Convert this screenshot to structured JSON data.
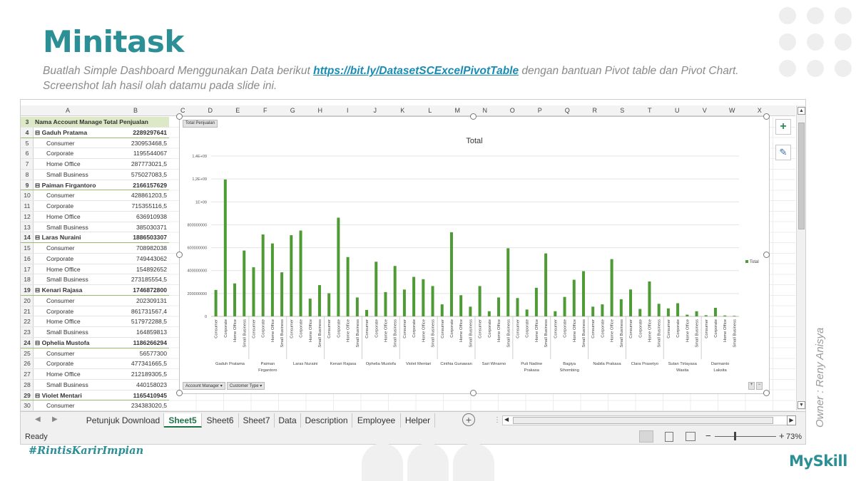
{
  "slide": {
    "title": "Minitask",
    "subtitle_pre": "Buatlah Simple Dashboard Menggunakan Data berikut ",
    "subtitle_link": "https://bit.ly/DatasetSCExcelPivotTable",
    "subtitle_post": " dengan bantuan Pivot table dan Pivot Chart. Screenshot lah hasil olah datamu pada slide ini.",
    "owner": "Owner : Reny Anisya",
    "hashtag": "#RintisKarirImpian",
    "brand": "MySkill"
  },
  "excel": {
    "columns": [
      "A",
      "B",
      "C",
      "D",
      "E",
      "F",
      "G",
      "H",
      "I",
      "J",
      "K",
      "L",
      "M",
      "N",
      "O",
      "P",
      "Q",
      "R",
      "S",
      "T",
      "U",
      "V",
      "W",
      "X"
    ],
    "header_row": {
      "row": "3",
      "a": "Nama Account Manage →",
      "b": "Total Penjualan"
    },
    "rows": [
      {
        "row": "4",
        "a": "⊟ Gaduh Pratama",
        "b": "2289297641",
        "type": "mgr"
      },
      {
        "row": "5",
        "a": "Consumer",
        "b": "230953468,5",
        "type": "sub"
      },
      {
        "row": "6",
        "a": "Corporate",
        "b": "1195544067",
        "type": "sub"
      },
      {
        "row": "7",
        "a": "Home Office",
        "b": "287773021,5",
        "type": "sub"
      },
      {
        "row": "8",
        "a": "Small Business",
        "b": "575027083,5",
        "type": "sub"
      },
      {
        "row": "9",
        "a": "⊟ Paiman Firgantoro",
        "b": "2166157629",
        "type": "mgr"
      },
      {
        "row": "10",
        "a": "Consumer",
        "b": "428861203,5",
        "type": "sub"
      },
      {
        "row": "11",
        "a": "Corporate",
        "b": "715355116,5",
        "type": "sub"
      },
      {
        "row": "12",
        "a": "Home Office",
        "b": "636910938",
        "type": "sub"
      },
      {
        "row": "13",
        "a": "Small Business",
        "b": "385030371",
        "type": "sub"
      },
      {
        "row": "14",
        "a": "⊟ Laras Nuraini",
        "b": "1886503307",
        "type": "mgr"
      },
      {
        "row": "15",
        "a": "Consumer",
        "b": "708982038",
        "type": "sub"
      },
      {
        "row": "16",
        "a": "Corporate",
        "b": "749443062",
        "type": "sub"
      },
      {
        "row": "17",
        "a": "Home Office",
        "b": "154892652",
        "type": "sub"
      },
      {
        "row": "18",
        "a": "Small Business",
        "b": "273185554,5",
        "type": "sub"
      },
      {
        "row": "19",
        "a": "⊟ Kenari Rajasa",
        "b": "1746872800",
        "type": "mgr"
      },
      {
        "row": "20",
        "a": "Consumer",
        "b": "202309131",
        "type": "sub"
      },
      {
        "row": "21",
        "a": "Corporate",
        "b": "861731567,4",
        "type": "sub"
      },
      {
        "row": "22",
        "a": "Home Office",
        "b": "517972288,5",
        "type": "sub"
      },
      {
        "row": "23",
        "a": "Small Business",
        "b": "164859813",
        "type": "sub"
      },
      {
        "row": "24",
        "a": "⊟ Ophelia Mustofa",
        "b": "1186266294",
        "type": "mgr"
      },
      {
        "row": "25",
        "a": "Consumer",
        "b": "56577300",
        "type": "sub"
      },
      {
        "row": "26",
        "a": "Corporate",
        "b": "477341665,5",
        "type": "sub"
      },
      {
        "row": "27",
        "a": "Home Office",
        "b": "212189305,5",
        "type": "sub"
      },
      {
        "row": "28",
        "a": "Small Business",
        "b": "440158023",
        "type": "sub"
      },
      {
        "row": "29",
        "a": "⊟ Violet Mentari",
        "b": "1165410945",
        "type": "mgr"
      },
      {
        "row": "30",
        "a": "Consumer",
        "b": "234383020,5",
        "type": "sub"
      }
    ],
    "tabs": [
      "Petunjuk Download",
      "Sheet5",
      "Sheet6",
      "Sheet7",
      "Data",
      "Description",
      "Employee",
      "Helper"
    ],
    "active_tab": "Sheet5",
    "status": "Ready",
    "zoom": "73%",
    "accent": "#217346"
  },
  "chart_data": {
    "type": "bar",
    "title": "Total",
    "field_button": "Total Penjualan",
    "axis_buttons": [
      "Account Manager ▾",
      "Customer Type ▾"
    ],
    "legend": "Total",
    "color": "#4e9a35",
    "ytick_labels": [
      "0",
      "200000000",
      "400000000",
      "600000000",
      "800000000",
      "1E+09",
      "1,2E+09",
      "1,4E+09"
    ],
    "yticks": [
      0,
      200000000,
      400000000,
      600000000,
      800000000,
      1000000000,
      1200000000,
      1400000000
    ],
    "ylim": [
      0,
      1400000000
    ],
    "subcategories": [
      "Consumer",
      "Corporate",
      "Home Office",
      "Small Business"
    ],
    "groups": [
      {
        "name": "Gaduh Pratama",
        "values": [
          230953468.5,
          1195544067,
          287773021.5,
          575027083.5
        ]
      },
      {
        "name": "Paiman Firgantoro",
        "values": [
          428861203.5,
          715355116.5,
          636910938,
          385030371
        ]
      },
      {
        "name": "Laras Nuraini",
        "values": [
          708982038,
          749443062,
          154892652,
          273185554.5
        ]
      },
      {
        "name": "Kenari Rajasa",
        "values": [
          202309131,
          861731567.4,
          517972288.5,
          164859813
        ]
      },
      {
        "name": "Ophelia Mustofa",
        "values": [
          56577300,
          477341665.5,
          212189305.5,
          440158023
        ]
      },
      {
        "name": "Violet Mentari",
        "values": [
          234383020.5,
          345000000,
          325000000,
          265000000
        ]
      },
      {
        "name": "Cinthia Gunawan",
        "values": [
          105000000,
          735000000,
          185000000,
          85000000
        ]
      },
      {
        "name": "Sari Winarno",
        "values": [
          265000000,
          45000000,
          165000000,
          595000000
        ]
      },
      {
        "name": "Puti Nadine Prakasa",
        "values": [
          160000000,
          60000000,
          250000000,
          550000000
        ]
      },
      {
        "name": "Bagiya Sihombing",
        "values": [
          45000000,
          170000000,
          320000000,
          395000000
        ]
      },
      {
        "name": "Nabila Prakasa",
        "values": [
          85000000,
          105000000,
          500000000,
          150000000
        ]
      },
      {
        "name": "Clara Prasetyo",
        "values": [
          235000000,
          65000000,
          305000000,
          110000000
        ]
      },
      {
        "name": "Sutan Tirtayasa Wasita",
        "values": [
          70000000,
          115000000,
          15000000,
          45000000
        ]
      },
      {
        "name": "Darmanto Laksita",
        "values": [
          10000000,
          75000000,
          8000000,
          5000000
        ]
      }
    ]
  }
}
